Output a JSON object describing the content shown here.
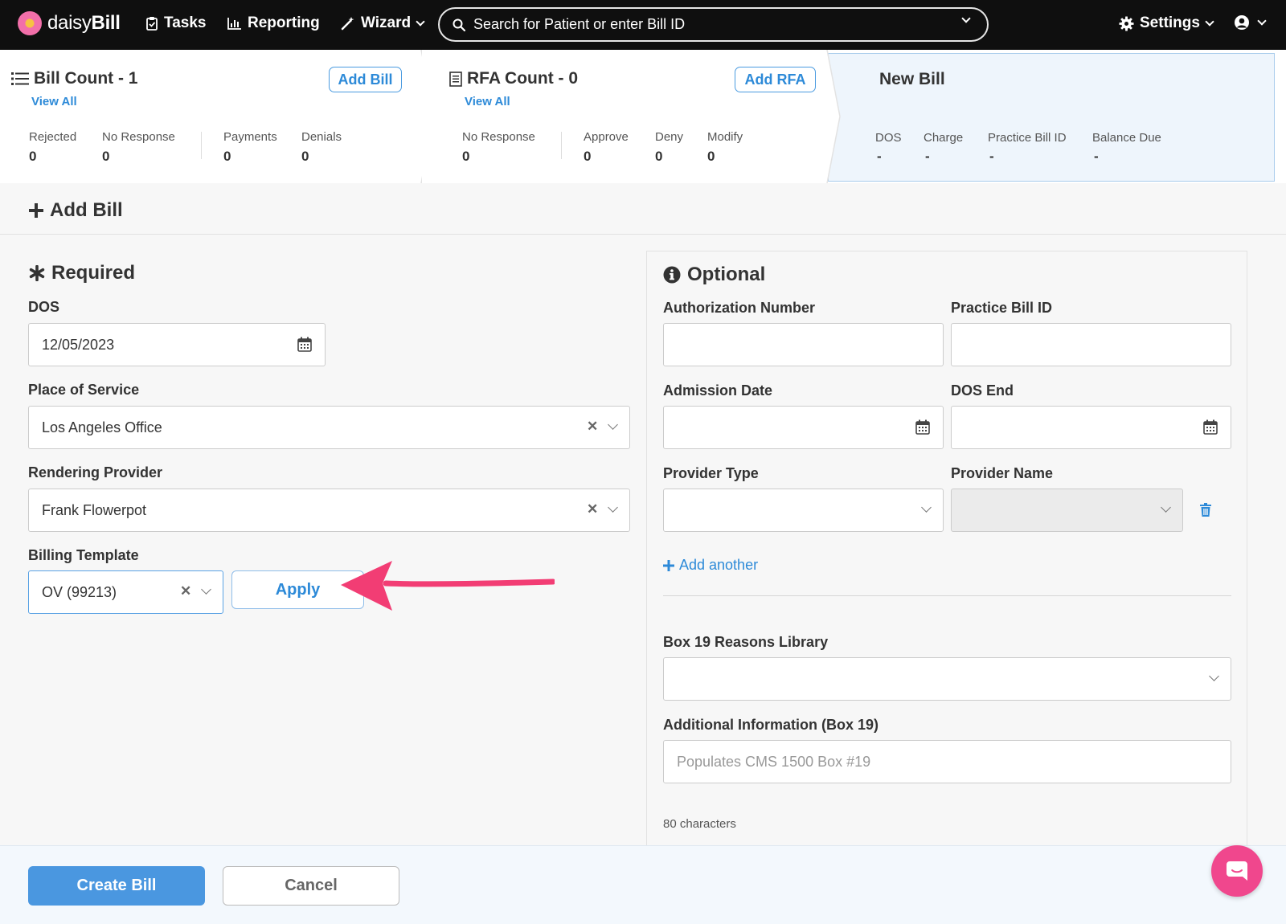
{
  "nav": {
    "logo_prefix": "daisy",
    "logo_suffix": "Bill",
    "tasks": "Tasks",
    "reporting": "Reporting",
    "wizard": "Wizard",
    "search_placeholder": "Search for Patient or enter Bill ID",
    "settings": "Settings"
  },
  "summary": {
    "bill": {
      "title": "Bill Count - 1",
      "view_all": "View All",
      "add_button": "Add Bill",
      "stats": [
        {
          "label": "Rejected",
          "value": "0"
        },
        {
          "label": "No Response",
          "value": "0"
        },
        {
          "label": "Payments",
          "value": "0"
        },
        {
          "label": "Denials",
          "value": "0"
        }
      ]
    },
    "rfa": {
      "title": "RFA Count - 0",
      "view_all": "View All",
      "add_button": "Add RFA",
      "stats": [
        {
          "label": "No Response",
          "value": "0"
        },
        {
          "label": "Approve",
          "value": "0"
        },
        {
          "label": "Deny",
          "value": "0"
        },
        {
          "label": "Modify",
          "value": "0"
        }
      ]
    },
    "new_bill": {
      "title": "New Bill",
      "stats": [
        {
          "label": "DOS",
          "value": "-"
        },
        {
          "label": "Charge",
          "value": "-"
        },
        {
          "label": "Practice Bill ID",
          "value": "-"
        },
        {
          "label": "Balance Due",
          "value": "-"
        }
      ]
    }
  },
  "page": {
    "title": "Add Bill"
  },
  "required": {
    "title": "Required",
    "dos_label": "DOS",
    "dos_value": "12/05/2023",
    "place_label": "Place of Service",
    "place_value": "Los Angeles Office",
    "provider_label": "Rendering Provider",
    "provider_value": "Frank Flowerpot",
    "template_label": "Billing Template",
    "template_value": "OV (99213)",
    "apply": "Apply"
  },
  "optional": {
    "title": "Optional",
    "auth_label": "Authorization Number",
    "practice_id_label": "Practice Bill ID",
    "admission_label": "Admission Date",
    "dos_end_label": "DOS End",
    "provider_type_label": "Provider Type",
    "provider_name_label": "Provider Name",
    "add_another": "Add another",
    "box19_label": "Box 19 Reasons Library",
    "additional_label": "Additional Information (Box 19)",
    "additional_placeholder": "Populates CMS 1500 Box #19",
    "char_note": "80 characters"
  },
  "footer": {
    "create": "Create Bill",
    "cancel": "Cancel"
  },
  "colors": {
    "accent": "#2d8ad8",
    "primary_button": "#4a97e0",
    "annotation_arrow": "#f23d74",
    "chat_bubble": "#f0478d"
  }
}
